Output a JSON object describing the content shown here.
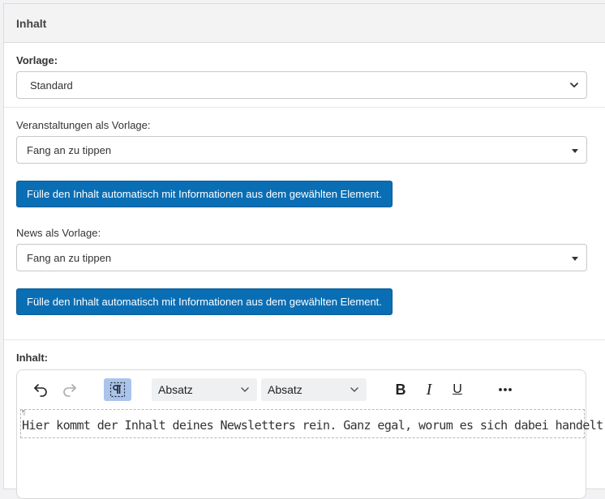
{
  "panel": {
    "title": "Inhalt"
  },
  "vorlage": {
    "label": "Vorlage:",
    "value": "Standard"
  },
  "veranstaltungen": {
    "label": "Veranstaltungen als Vorlage:",
    "placeholder": "Fang an zu tippen",
    "button": "Fülle den Inhalt automatisch mit Informationen aus dem gewählten Element."
  },
  "news": {
    "label": "News als Vorlage:",
    "placeholder": "Fang an zu tippen",
    "button": "Fülle den Inhalt automatisch mit Informationen aus dem gewählten Element."
  },
  "inhalt": {
    "label": "Inhalt:",
    "toolbar": {
      "block_format": "Absatz",
      "font_format": "Absatz",
      "bold": "B",
      "italic": "I",
      "underline": "U",
      "icons": [
        "undo-icon",
        "redo-icon",
        "show-blocks-icon",
        "chevron-down-icon",
        "more-icon"
      ]
    },
    "content": "Hier kommt der Inhalt deines Newsletters rein. Ganz egal, worum es sich dabei handelt."
  },
  "colors": {
    "primary": "#0a6eb4",
    "active_tool": "#aac4ec",
    "header_bg": "#f3f3f4"
  }
}
